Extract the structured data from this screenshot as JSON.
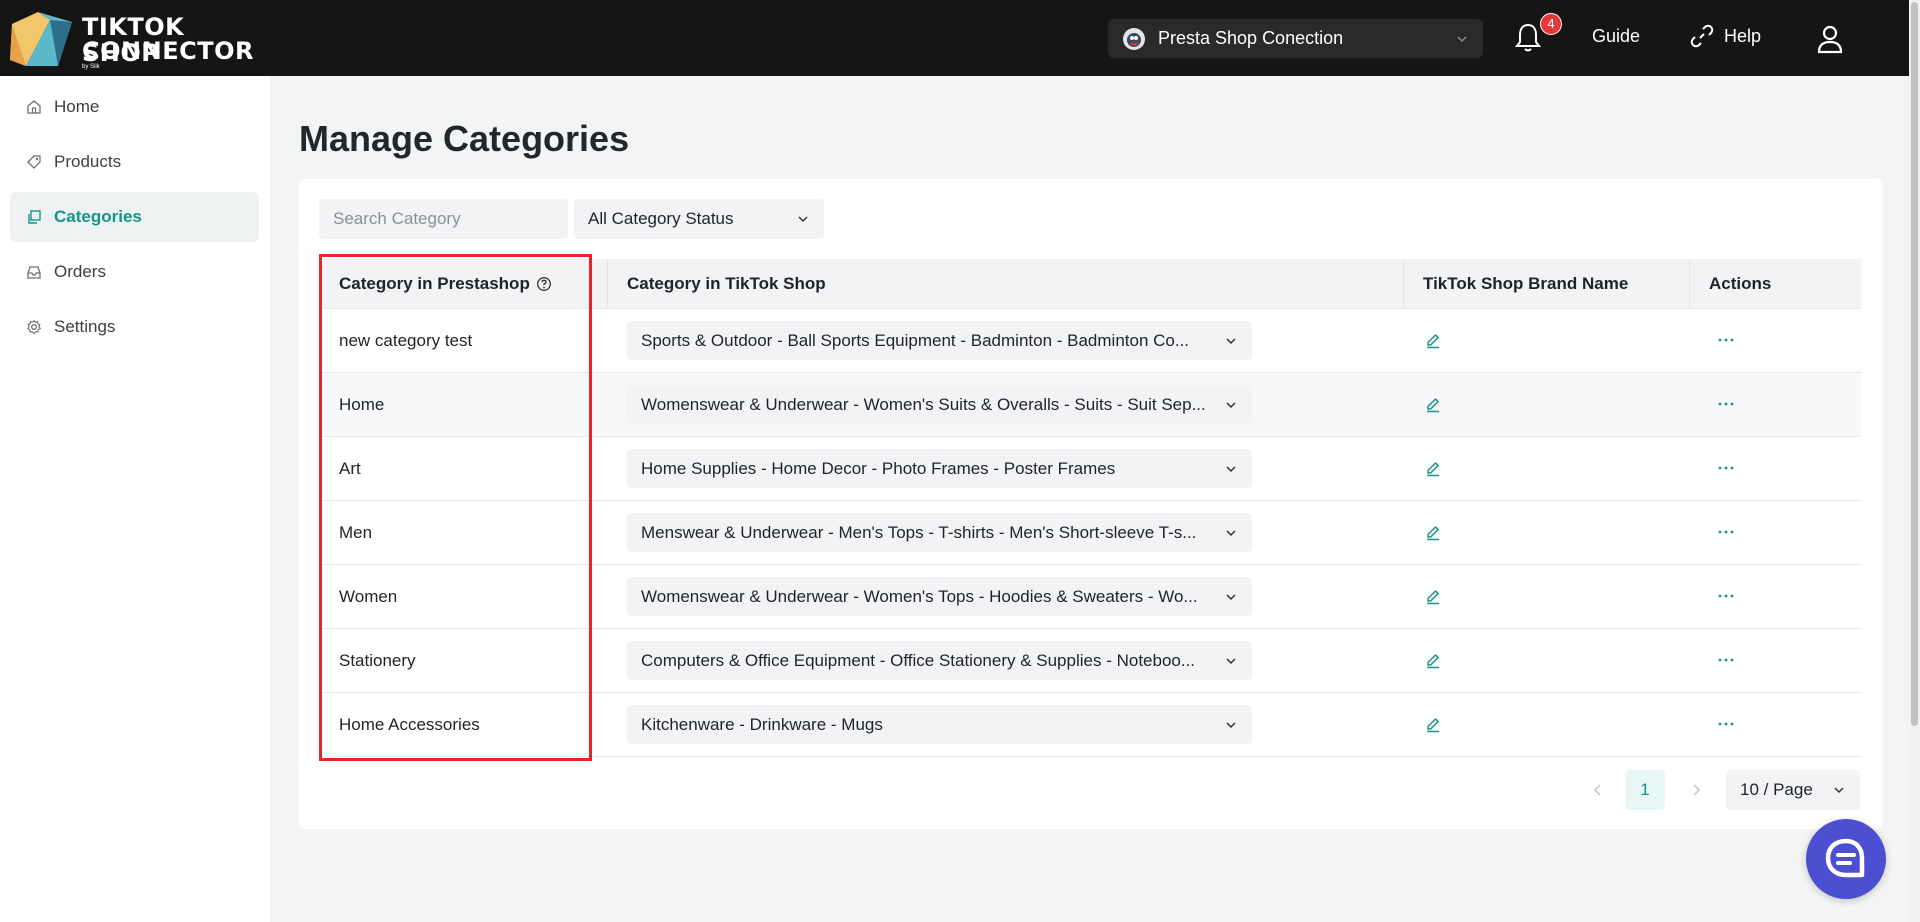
{
  "header": {
    "logo_line1": "TIKTOK SHOP",
    "logo_line2": "CONNECTOR",
    "logo_byline": "by Silk",
    "shop_select_label": "Presta Shop Conection",
    "notification_count": "4",
    "guide_label": "Guide",
    "help_label": "Help"
  },
  "sidebar": {
    "items": [
      {
        "label": "Home",
        "icon": "home-icon",
        "active": false
      },
      {
        "label": "Products",
        "icon": "tag-icon",
        "active": false
      },
      {
        "label": "Categories",
        "icon": "copy-icon",
        "active": true
      },
      {
        "label": "Orders",
        "icon": "inbox-icon",
        "active": false
      },
      {
        "label": "Settings",
        "icon": "gear-icon",
        "active": false
      }
    ]
  },
  "main": {
    "title": "Manage Categories",
    "search_placeholder": "Search Category",
    "status_filter_label": "All Category Status",
    "columns": {
      "prestashop": "Category in Prestashop",
      "tiktok": "Category in TikTok Shop",
      "brand": "TikTok Shop Brand Name",
      "actions": "Actions"
    },
    "rows": [
      {
        "name": "new category test",
        "tiktok": "Sports & Outdoor - Ball Sports Equipment - Badminton - Badminton Co..."
      },
      {
        "name": "Home",
        "tiktok": "Womenswear & Underwear - Women's Suits & Overalls - Suits - Suit Sep..."
      },
      {
        "name": "Art",
        "tiktok": "Home Supplies - Home Decor - Photo Frames - Poster Frames"
      },
      {
        "name": "Men",
        "tiktok": "Menswear & Underwear - Men's Tops - T-shirts - Men's Short-sleeve T-s..."
      },
      {
        "name": "Women",
        "tiktok": "Womenswear & Underwear - Women's Tops - Hoodies & Sweaters - Wo..."
      },
      {
        "name": "Stationery",
        "tiktok": "Computers & Office Equipment - Office Stationery & Supplies - Noteboo..."
      },
      {
        "name": "Home Accessories",
        "tiktok": "Kitchenware - Drinkware - Mugs"
      }
    ],
    "pagination": {
      "current_page": "1",
      "page_size_label": "10  / Page"
    }
  },
  "colors": {
    "accent": "#16938b",
    "header_bg": "#151515",
    "highlight": "#e8232a",
    "chat": "#4d4fd1",
    "badge": "#e6373a"
  }
}
